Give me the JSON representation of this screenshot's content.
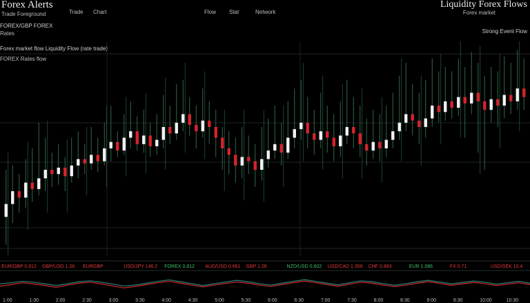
{
  "header": {
    "title_left": "Forex Alerts",
    "subtitle_left": "Trade Foreground",
    "menu": [
      "Trade",
      "Chart",
      "Flow",
      "Stat",
      "Network"
    ],
    "title_right": "Liquidity Forex Flows",
    "subtitle_right": "Forex market"
  },
  "panel_left": {
    "pair_label": "FOREX/GBP FOREX",
    "pair_sub": "Rates",
    "info_line": "Forex market flow Liquidity Flow (rate trade)",
    "info_sub": "FOREX Rates flow"
  },
  "panel_right": {
    "strength_label": "Strong Event Flow"
  },
  "colors": {
    "background": "#000000",
    "grid": "#4a5a4f",
    "bull": "#f2f2f2",
    "bear": "#d4232b",
    "wick": "#2f6a4a",
    "osc_red": "#c62828",
    "osc_teal": "#2a7b73",
    "ticker_red": "#e23a3a",
    "ticker_green": "#3fbf6a"
  },
  "ticker": [
    {
      "text": "EUR/GBP 0.812",
      "color": "red"
    },
    {
      "text": "GBP/USD 1.28",
      "color": "red"
    },
    {
      "text": "EURGBP",
      "color": "red"
    },
    {
      "text": "USD/JPY 146.2",
      "color": "red"
    },
    {
      "text": "FOREX 0.812",
      "color": "green"
    },
    {
      "text": "AUD/USD 0.661",
      "color": "red"
    },
    {
      "text": "GBP 1.28",
      "color": "red"
    },
    {
      "text": "NZD/USD 0.602",
      "color": "green"
    },
    {
      "text": "USD/CAD 1.356",
      "color": "red"
    },
    {
      "text": "CHF 0.883",
      "color": "red"
    },
    {
      "text": "EUR 1.086",
      "color": "green"
    },
    {
      "text": "FX 0.71",
      "color": "red"
    },
    {
      "text": "USD/SEK 10.4",
      "color": "red"
    }
  ],
  "axis_labels": [
    "1:00",
    "1:30",
    "2:00",
    "2:30",
    "3:00",
    "3:30",
    "4:00",
    "4:30",
    "5:00",
    "5:30",
    "6:00",
    "6:30",
    "7:00",
    "7:30",
    "8:00",
    "8:30",
    "9:00",
    "9:30",
    "10:00",
    "10:30"
  ],
  "chart_data": {
    "type": "candlestick",
    "candles": [
      [
        0.18,
        0.24,
        0.05,
        0.4
      ],
      [
        0.24,
        0.3,
        0.15,
        0.42
      ],
      [
        0.3,
        0.27,
        0.2,
        0.38
      ],
      [
        0.27,
        0.34,
        0.22,
        0.45
      ],
      [
        0.34,
        0.31,
        0.25,
        0.5
      ],
      [
        0.31,
        0.36,
        0.28,
        0.62
      ],
      [
        0.36,
        0.4,
        0.3,
        0.55
      ],
      [
        0.4,
        0.38,
        0.32,
        0.48
      ],
      [
        0.38,
        0.41,
        0.33,
        0.52
      ],
      [
        0.41,
        0.37,
        0.3,
        0.46
      ],
      [
        0.37,
        0.42,
        0.34,
        0.55
      ],
      [
        0.42,
        0.45,
        0.36,
        0.58
      ],
      [
        0.45,
        0.43,
        0.38,
        0.52
      ],
      [
        0.43,
        0.47,
        0.4,
        0.6
      ],
      [
        0.47,
        0.44,
        0.39,
        0.55
      ],
      [
        0.44,
        0.5,
        0.42,
        0.62
      ],
      [
        0.5,
        0.53,
        0.44,
        0.7
      ],
      [
        0.53,
        0.49,
        0.46,
        0.58
      ],
      [
        0.49,
        0.55,
        0.47,
        0.66
      ],
      [
        0.55,
        0.58,
        0.5,
        0.72
      ],
      [
        0.58,
        0.52,
        0.49,
        0.65
      ],
      [
        0.52,
        0.56,
        0.48,
        0.68
      ],
      [
        0.56,
        0.51,
        0.46,
        0.62
      ],
      [
        0.51,
        0.54,
        0.47,
        0.66
      ],
      [
        0.54,
        0.6,
        0.5,
        0.75
      ],
      [
        0.6,
        0.57,
        0.52,
        0.7
      ],
      [
        0.57,
        0.62,
        0.54,
        0.8
      ],
      [
        0.62,
        0.66,
        0.58,
        0.82
      ],
      [
        0.66,
        0.61,
        0.56,
        0.74
      ],
      [
        0.61,
        0.58,
        0.5,
        0.7
      ],
      [
        0.58,
        0.63,
        0.55,
        0.78
      ],
      [
        0.63,
        0.6,
        0.52,
        0.72
      ],
      [
        0.6,
        0.55,
        0.46,
        0.68
      ],
      [
        0.55,
        0.5,
        0.4,
        0.6
      ],
      [
        0.5,
        0.47,
        0.38,
        0.58
      ],
      [
        0.47,
        0.42,
        0.34,
        0.55
      ],
      [
        0.42,
        0.46,
        0.36,
        0.6
      ],
      [
        0.46,
        0.44,
        0.38,
        0.56
      ],
      [
        0.44,
        0.4,
        0.32,
        0.52
      ],
      [
        0.4,
        0.45,
        0.35,
        0.6
      ],
      [
        0.45,
        0.49,
        0.41,
        0.64
      ],
      [
        0.49,
        0.52,
        0.45,
        0.7
      ],
      [
        0.52,
        0.48,
        0.42,
        0.62
      ],
      [
        0.48,
        0.55,
        0.45,
        0.72
      ],
      [
        0.55,
        0.59,
        0.5,
        0.78
      ],
      [
        0.59,
        0.62,
        0.54,
        0.82
      ],
      [
        0.62,
        0.57,
        0.5,
        0.74
      ],
      [
        0.57,
        0.54,
        0.47,
        0.68
      ],
      [
        0.54,
        0.58,
        0.5,
        0.76
      ],
      [
        0.58,
        0.55,
        0.48,
        0.7
      ],
      [
        0.55,
        0.51,
        0.44,
        0.66
      ],
      [
        0.51,
        0.56,
        0.46,
        0.72
      ],
      [
        0.56,
        0.6,
        0.52,
        0.82
      ],
      [
        0.6,
        0.57,
        0.5,
        0.74
      ],
      [
        0.57,
        0.52,
        0.46,
        0.7
      ],
      [
        0.52,
        0.49,
        0.42,
        0.64
      ],
      [
        0.49,
        0.53,
        0.45,
        0.68
      ],
      [
        0.53,
        0.5,
        0.44,
        0.66
      ],
      [
        0.5,
        0.54,
        0.46,
        0.7
      ],
      [
        0.54,
        0.58,
        0.5,
        0.76
      ],
      [
        0.58,
        0.62,
        0.54,
        0.84
      ],
      [
        0.62,
        0.66,
        0.58,
        0.9
      ],
      [
        0.66,
        0.63,
        0.56,
        0.8
      ],
      [
        0.63,
        0.6,
        0.52,
        0.76
      ],
      [
        0.6,
        0.64,
        0.55,
        0.82
      ],
      [
        0.64,
        0.7,
        0.6,
        0.92
      ],
      [
        0.7,
        0.67,
        0.62,
        0.86
      ],
      [
        0.67,
        0.72,
        0.63,
        0.88
      ],
      [
        0.72,
        0.69,
        0.64,
        0.86
      ],
      [
        0.69,
        0.74,
        0.65,
        0.92
      ],
      [
        0.74,
        0.71,
        0.55,
        0.88
      ],
      [
        0.71,
        0.76,
        0.66,
        0.95
      ],
      [
        0.76,
        0.72,
        0.48,
        0.9
      ],
      [
        0.72,
        0.68,
        0.4,
        0.84
      ],
      [
        0.68,
        0.73,
        0.62,
        0.88
      ],
      [
        0.73,
        0.7,
        0.6,
        0.86
      ],
      [
        0.7,
        0.75,
        0.64,
        0.93
      ],
      [
        0.75,
        0.72,
        0.66,
        0.9
      ],
      [
        0.72,
        0.78,
        0.68,
        0.96
      ],
      [
        0.78,
        0.74,
        0.68,
        0.92
      ]
    ],
    "oscillator": {
      "red": [
        0.45,
        0.52,
        0.6,
        0.55,
        0.48,
        0.4,
        0.5,
        0.58,
        0.62,
        0.55,
        0.46,
        0.38,
        0.44,
        0.52,
        0.6,
        0.66,
        0.58,
        0.5,
        0.42,
        0.5,
        0.57,
        0.63,
        0.58,
        0.5,
        0.44,
        0.52,
        0.6,
        0.67,
        0.6,
        0.52,
        0.45,
        0.54,
        0.62,
        0.58,
        0.5,
        0.43,
        0.5,
        0.58,
        0.64,
        0.57,
        0.49,
        0.55,
        0.61,
        0.56,
        0.48,
        0.54,
        0.6,
        0.52
      ],
      "teal": [
        0.55,
        0.6,
        0.66,
        0.62,
        0.55,
        0.48,
        0.56,
        0.64,
        0.68,
        0.62,
        0.54,
        0.46,
        0.5,
        0.58,
        0.66,
        0.72,
        0.64,
        0.56,
        0.48,
        0.56,
        0.63,
        0.7,
        0.64,
        0.56,
        0.5,
        0.58,
        0.66,
        0.73,
        0.66,
        0.58,
        0.51,
        0.6,
        0.68,
        0.64,
        0.56,
        0.49,
        0.56,
        0.64,
        0.7,
        0.63,
        0.55,
        0.61,
        0.67,
        0.62,
        0.54,
        0.6,
        0.66,
        0.58
      ]
    }
  }
}
